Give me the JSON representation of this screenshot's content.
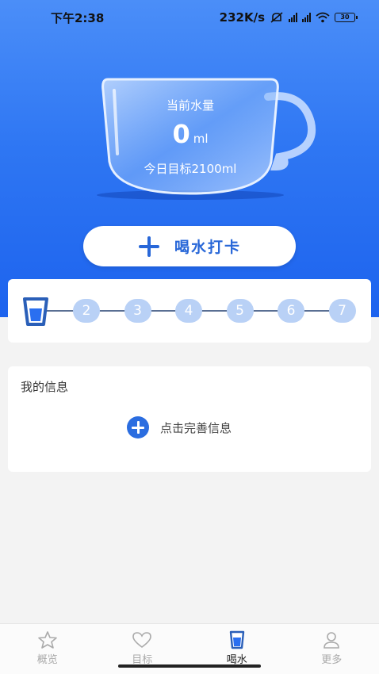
{
  "status": {
    "time": "下午2:38",
    "speed": "232K/s",
    "battery": "30"
  },
  "cup": {
    "title": "当前水量",
    "amount": "0",
    "unit": "ml",
    "goal": "今日目标2100ml"
  },
  "checkin": {
    "label": "喝水打卡"
  },
  "progress": {
    "current_step": 1,
    "steps": [
      "2",
      "3",
      "4",
      "5",
      "6",
      "7"
    ]
  },
  "info": {
    "title": "我的信息",
    "action": "点击完善信息"
  },
  "tabs": [
    {
      "label": "概览",
      "icon": "star-icon"
    },
    {
      "label": "目标",
      "icon": "heart-icon"
    },
    {
      "label": "喝水",
      "icon": "cup-icon",
      "active": true
    },
    {
      "label": "更多",
      "icon": "user-icon"
    }
  ],
  "colors": {
    "brand_blue": "#2f77f3",
    "button_text": "#2867d8",
    "step_inactive": "#b9d1f6"
  }
}
